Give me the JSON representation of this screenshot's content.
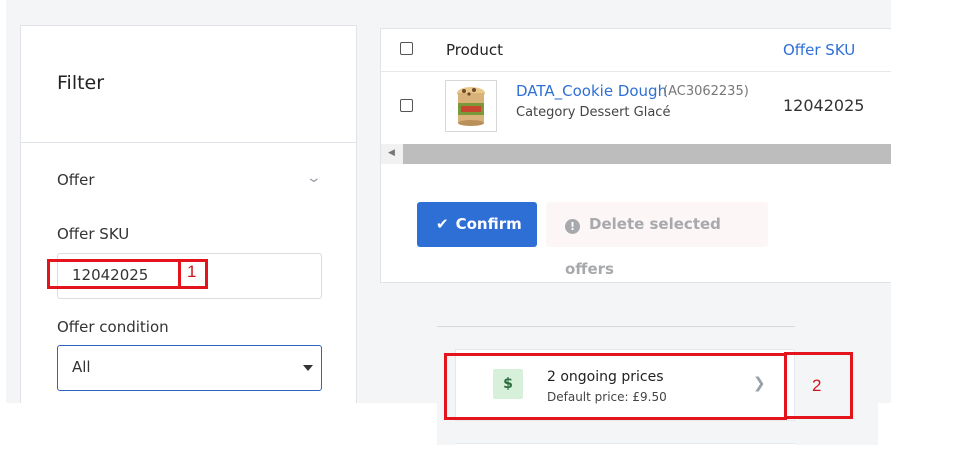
{
  "filter": {
    "title": "Filter",
    "section_label": "Offer",
    "offer_sku_label": "Offer SKU",
    "offer_sku_value": "12042025",
    "offer_condition_label": "Offer condition",
    "offer_condition_value": "All"
  },
  "table": {
    "headers": {
      "product": "Product",
      "offer_sku": "Offer SKU"
    },
    "rows": [
      {
        "name": "DATA_Cookie Dough",
        "code": "(AC3062235)",
        "category": "Category Dessert Glacé",
        "sku": "12042025"
      }
    ]
  },
  "actions": {
    "confirm_label": "Confirm",
    "delete_label": "Delete selected offers"
  },
  "prices": {
    "title": "2 ongoing prices",
    "subtitle": "Default price: £9.50",
    "icon_text": "$"
  },
  "annotations": {
    "one": "1",
    "two": "2"
  },
  "colors": {
    "accent": "#2e6fd6",
    "annotation": "#e3141b",
    "price_icon_bg": "#d6f0da"
  }
}
